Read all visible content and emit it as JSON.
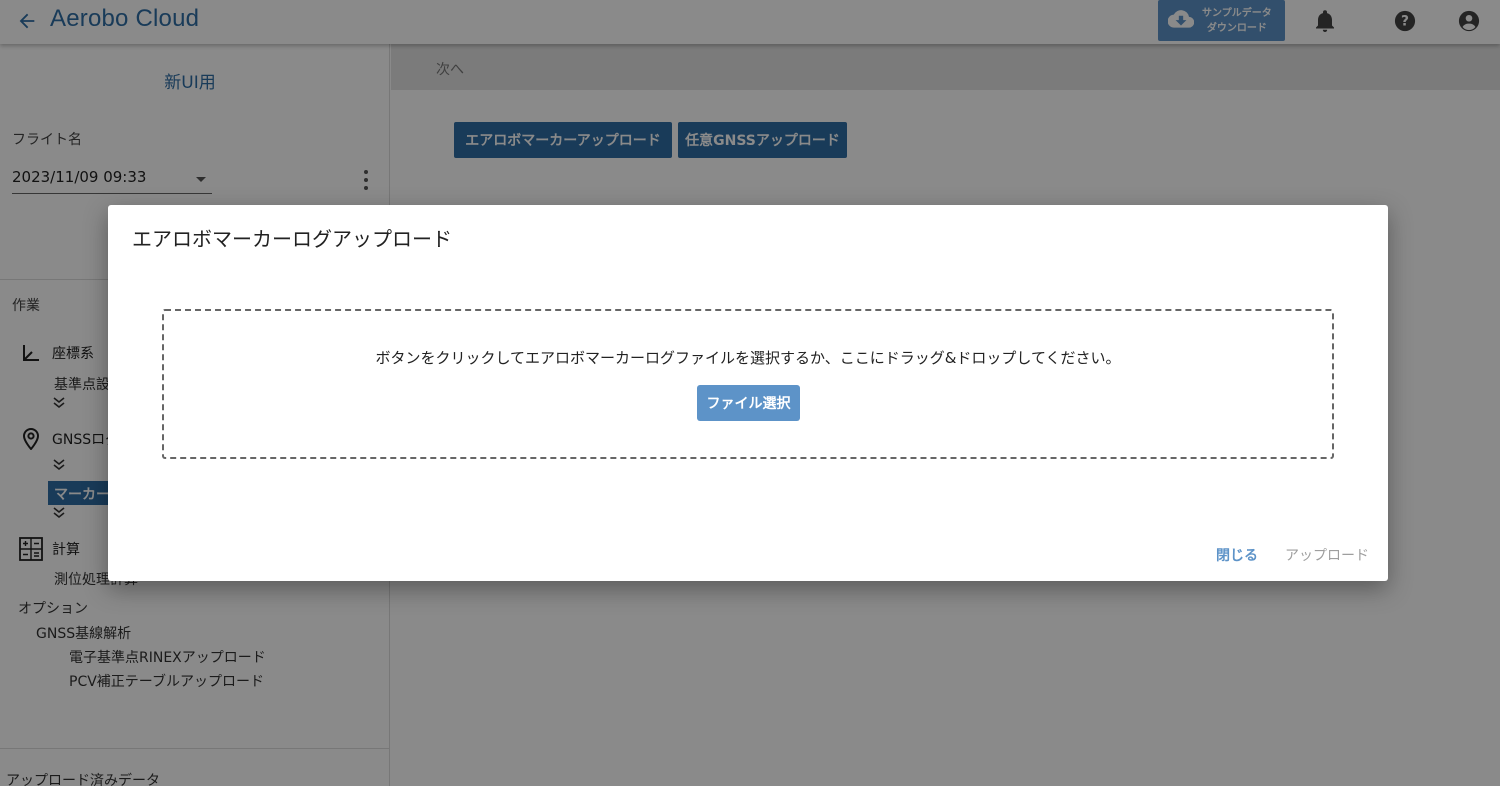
{
  "app": {
    "title": "Aerobo Cloud",
    "download_line1": "サンプルデータ",
    "download_line2": "ダウンロード"
  },
  "sidebar": {
    "project_title": "新UI用",
    "flight_label": "フライト名",
    "flight_value": "2023/11/09 09:33",
    "work_label": "作業",
    "sections": {
      "coord": "座標系",
      "coord_sub": "基準点設",
      "gnss": "GNSSログ",
      "marker": "マーカー",
      "calc": "計算",
      "calc_sub": "測位処理計算"
    },
    "options_label": "オプション",
    "gnss_baseline": "GNSS基線解析",
    "rinex_upload": "電子基準点RINEXアップロード",
    "pcv_upload": "PCV補正テーブルアップロード",
    "uploaded_data": "アップロード済みデータ"
  },
  "main": {
    "step_next": "次へ",
    "btn_marker_upload": "エアロボマーカーアップロード",
    "btn_gnss_upload": "任意GNSSアップロード"
  },
  "dialog": {
    "title": "エアロボマーカーログアップロード",
    "drop_message": "ボタンをクリックしてエアロボマーカーログファイルを選択するか、ここにドラッグ&ドロップしてください。",
    "file_select": "ファイル選択",
    "close": "閉じる",
    "upload": "アップロード"
  },
  "colors": {
    "brand": "#2f6ea5",
    "button_light": "#5d93c8",
    "disabled": "#9e9e9e"
  }
}
